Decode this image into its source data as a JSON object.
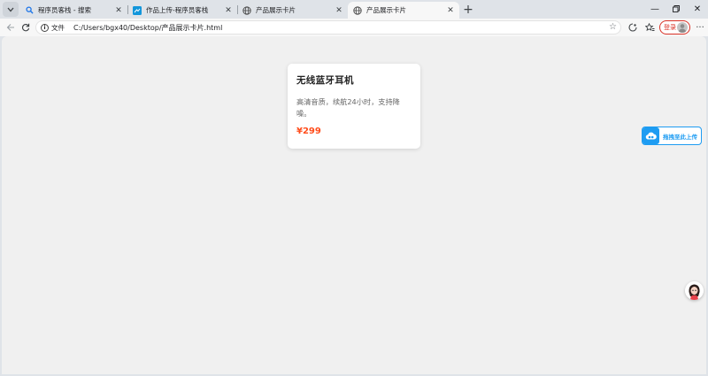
{
  "tabs": [
    {
      "title": "程序员客栈 - 搜索",
      "icon": "search-icon"
    },
    {
      "title": "作品上传-程序员客栈",
      "icon": "site-icon"
    },
    {
      "title": "产品展示卡片",
      "icon": "globe-icon"
    },
    {
      "title": "产品展示卡片",
      "icon": "globe-icon",
      "active": true
    }
  ],
  "address": {
    "scheme_label": "文件",
    "url": "C:/Users/bgx40/Desktop/产品展示卡片.html"
  },
  "account": {
    "login_label": "登录"
  },
  "card": {
    "title": "无线蓝牙耳机",
    "description": "高清音质，续航24小时，支持降噪。",
    "price": "¥299"
  },
  "upload_widget": {
    "label": "拖拽至此上传"
  },
  "colors": {
    "price": "#ff4d1c",
    "upload_accent": "#1e9cf2",
    "login_accent": "#d93025",
    "page_bg": "#f0f0f0"
  }
}
